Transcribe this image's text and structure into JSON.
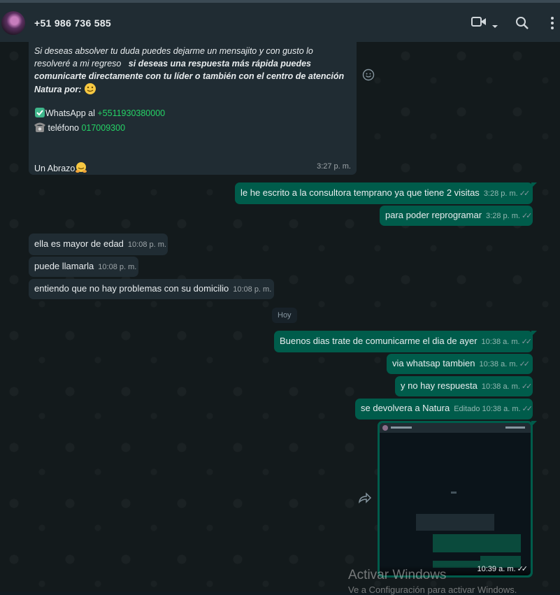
{
  "contact": {
    "name": "+51 986 736 585"
  },
  "header_icons": [
    "video-call-icon",
    "chevron-down-icon",
    "search-icon",
    "kebab-menu-icon"
  ],
  "first_message": {
    "line1": "Si deseas absolver tu duda puedes dejarme un mensajito y con gusto lo",
    "line2a": "resolveré a mi regreso",
    "line2b": "si deseas una respuesta más rápida puedes",
    "line3": "comunicarte directamente con tu líder o también con el centro de atención",
    "line4": "Natura por:",
    "whatsapp_label": "WhatsApp al",
    "whatsapp_number": "+5511930380000",
    "phone_label": "teléfono",
    "phone_number": "017009300",
    "closing": "Un Abrazo",
    "time": "3:27 p. m."
  },
  "messages": [
    {
      "dir": "out",
      "text": "le he escrito a la consultora temprano ya que tiene 2 visitas",
      "time": "3:28 p. m."
    },
    {
      "dir": "out",
      "text": "para poder reprogramar",
      "time": "3:28 p. m."
    },
    {
      "dir": "in",
      "text": "ella es mayor de edad",
      "time": "10:08 p. m."
    },
    {
      "dir": "in",
      "text": "puede llamarla",
      "time": "10:08 p. m."
    },
    {
      "dir": "in",
      "text": "entiendo que no hay problemas con su domicilio",
      "time": "10:08 p. m."
    },
    {
      "dir": "out",
      "text": "Buenos dias trate de comunicarme el dia de ayer",
      "time": "10:38 a. m."
    },
    {
      "dir": "out",
      "text": "via whatsap tambien",
      "time": "10:38 a. m."
    },
    {
      "dir": "out",
      "text": "y no hay respuesta",
      "time": "10:38 a. m."
    },
    {
      "dir": "out",
      "text": "se devolvera a Natura",
      "edited": "Editado",
      "time": "10:38 a. m."
    }
  ],
  "day_separator": "Hoy",
  "image_message": {
    "time": "10:39 a. m."
  },
  "watermark": {
    "title": "Activar Windows",
    "subtitle": "Ve a Configuración para activar Windows."
  },
  "colors": {
    "header": "#202c33",
    "incoming": "#202c33",
    "outgoing": "#005c4b",
    "link": "#25d366"
  }
}
